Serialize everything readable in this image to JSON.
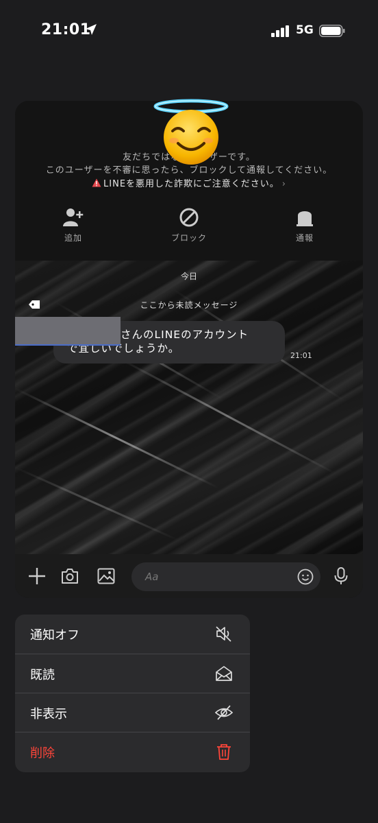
{
  "status_bar": {
    "time": "21:01",
    "network": "5G"
  },
  "notice": {
    "line1": "友だちではないユーザーです。",
    "line2": "このユーザーを不審に思ったら、ブロックして通報してください。",
    "line3": "LINEを悪用した詐欺にご注意ください。"
  },
  "actions": {
    "add": "追加",
    "block": "ブロック",
    "report": "通報"
  },
  "chat": {
    "date_label": "今日",
    "unread_label": "ここから未読メッセージ",
    "message_line1": "さんのLINEのアカウント",
    "message_line2": "で宜しいでしょうか。",
    "message_time": "21:01"
  },
  "input": {
    "placeholder": "Aa"
  },
  "menu": {
    "items": [
      {
        "label": "通知オフ",
        "icon": "speaker-mute-icon"
      },
      {
        "label": "既読",
        "icon": "open-envelope-icon"
      },
      {
        "label": "非表示",
        "icon": "eye-slash-icon"
      },
      {
        "label": "削除",
        "icon": "trash-icon"
      }
    ],
    "danger_color": "#ff453a"
  }
}
